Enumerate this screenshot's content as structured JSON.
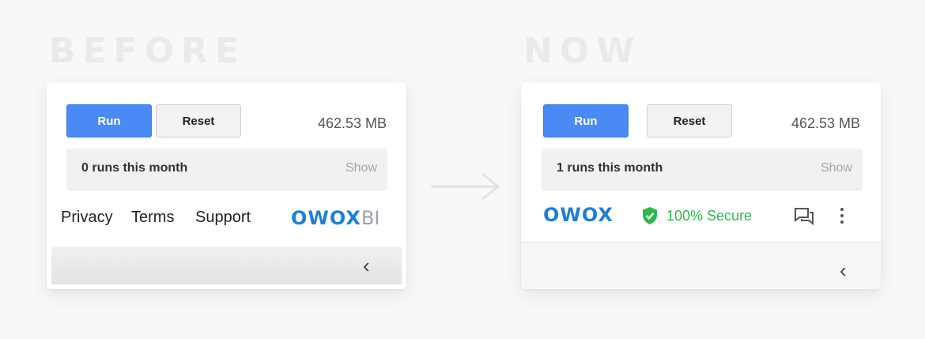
{
  "before": {
    "heading": "BEFORE",
    "run_label": "Run",
    "reset_label": "Reset",
    "size": "462.53 MB",
    "runs_text": "0 runs this month",
    "show_label": "Show",
    "footer_links": [
      "Privacy",
      "Terms",
      "Support"
    ],
    "logo": "OWOX",
    "logo_suffix": "BI",
    "collapse_icon": "chevron-left-icon"
  },
  "now": {
    "heading": "NOW",
    "run_label": "Run",
    "reset_label": "Reset",
    "size": "462.53 MB",
    "runs_text": "1 runs this month",
    "show_label": "Show",
    "logo": "OWOX",
    "secure_text": "100% Secure",
    "icons": [
      "shield-check-icon",
      "feedback-icon",
      "more-vertical-icon",
      "chevron-left-icon"
    ]
  },
  "colors": {
    "accent": "#4a8af4",
    "logo": "#1e7fd6",
    "secure": "#2db84c",
    "heading": "#eaeaea"
  }
}
